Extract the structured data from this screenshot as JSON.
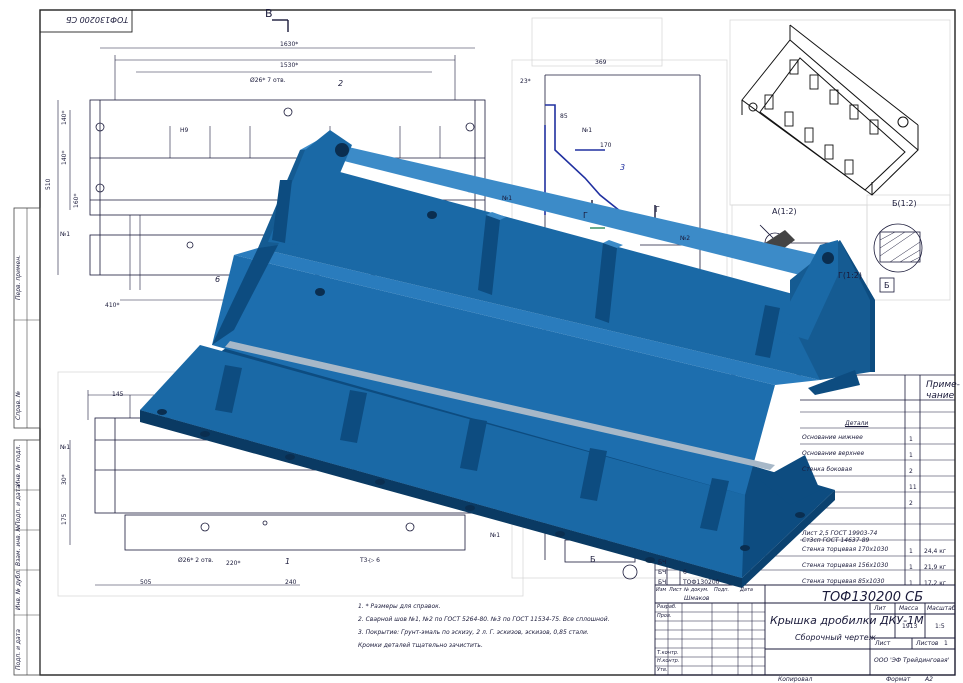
{
  "drawing": {
    "code_top_left": "ТОФ130200 СБ",
    "section_mark": "В",
    "title_block": {
      "designation": "ТОФ130200 СБ",
      "name": "Крышка дробилки ДКУ-1М",
      "doc_type": "Сборочный чертеж",
      "mass_label": "Масса",
      "scale_label": "Масштаб",
      "lit_label": "Лит",
      "mass_value": "1913",
      "scale_value": "1:5",
      "sheet_label": "Лист",
      "sheets_label": "Листов",
      "sheets_value": "1",
      "org": "ООО 'ЭФ Трейдинговая'",
      "copied": "Копировал",
      "format_label": "Формат",
      "format_value": "А2",
      "row_labels": [
        "Изм",
        "Лист",
        "№ докум.",
        "Подп.",
        "Дата"
      ],
      "role_labels": [
        "Разраб.",
        "Пров.",
        "Т.контр.",
        "Н.контр.",
        "Утв."
      ],
      "developer": "Шмаков"
    },
    "spec_table": {
      "header_note": "Приме-\nчание",
      "section": "Детали",
      "rows": [
        {
          "name": "Основание нижнее",
          "qty": "1",
          "note": ""
        },
        {
          "name": "Основание верхнее",
          "qty": "1",
          "note": ""
        },
        {
          "name": "Стенка боковая",
          "qty": "2",
          "note": ""
        },
        {
          "name": "",
          "qty": "11",
          "note": ""
        },
        {
          "name": "",
          "qty": "2",
          "note": ""
        },
        {
          "name": "",
          "qty": "",
          "note": ""
        },
        {
          "name": "Лист 2,5 ГОСТ 19903-74\nСт3сп ГОСТ 14637-89",
          "qty": "",
          "note": ""
        },
        {
          "name": "Стенка торцевая 170х1030",
          "qty": "1",
          "note": "24,4 кг"
        },
        {
          "name": "Стенка торцевая 156х1030",
          "qty": "1",
          "note": "21,9 кг"
        },
        {
          "name": "Стенка торцевая 85х1030",
          "qty": "1",
          "note": "17,2 кг"
        }
      ],
      "row_formats": [
        "БЧ",
        "БЧ",
        "БЧ"
      ],
      "row_nums": [
        "",
        "6",
        "ТОФ130200"
      ]
    },
    "notes": [
      "1. * Размеры для справок.",
      "2. Сварной шов №1, №2 по ГОСТ 5264-80. №3 по ГОСТ 11534-75. Все сплошной.",
      "3. Покрытие: Грунт-эмаль по эскизу, 2 л. Г. эскизов, эскизов, 0,85 стали.",
      "Кромки деталей тщательно зачистить."
    ],
    "view_labels": {
      "section_a": "А(1:2)",
      "section_b": "Б(1:2)",
      "view_g": "Г(1:2)",
      "view_b_callout": "Б",
      "view_g_callout": "Г"
    },
    "weld_labels": [
      "№1",
      "№2",
      "№3"
    ],
    "part_callouts": [
      "1",
      "2",
      "3",
      "6"
    ],
    "dims": {
      "top_width": "1630*",
      "top_inner": "1530*",
      "side_height": "510",
      "side_dims": [
        "140*",
        "140*",
        "160*"
      ],
      "mid_dim": "369",
      "mid_dim2": "23*",
      "mid_dim3": "85",
      "mid_dim4": "170",
      "bottom_dims": [
        "505",
        "240",
        "220*"
      ],
      "bottom_holes": "Ø26*\n2 отв.",
      "hole_label": "Ø26*\n7 отв.",
      "lower_left": [
        "145",
        "30*",
        "175"
      ],
      "lower_r": "Т3-▷ 6",
      "misc": "Н9",
      "k": "410*"
    },
    "side_columns": [
      "Перв. примен.",
      "Справ. №",
      "Подп. и дата",
      "Инв. № дубл.",
      "Взам. инв. №",
      "Подп. и дата",
      "Инв. № подл."
    ],
    "colors": {
      "model_main": "#1a69a6",
      "model_dark": "#0d4c80",
      "model_light": "#3c8bc8",
      "line": "#1a1a3a",
      "dim_blue": "#2030a0",
      "weld_green": "#2a8a5a"
    }
  }
}
